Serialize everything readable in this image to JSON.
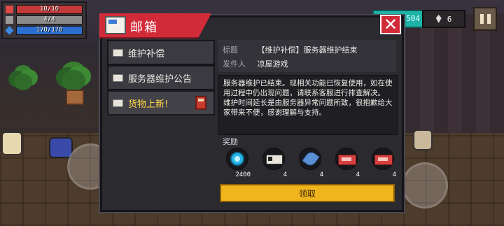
{
  "hud": {
    "hp": "10/10",
    "armor": "4/4",
    "energy": "170/170",
    "top_value": "504",
    "gems": "6"
  },
  "mailbox": {
    "title": "邮箱",
    "items": [
      {
        "label": "维护补偿"
      },
      {
        "label": "服务器维护公告"
      },
      {
        "label": "货物上新!"
      }
    ],
    "selected": 0,
    "meta": {
      "title_key": "标题",
      "title_value": "【维护补偿】服务器维护结束",
      "sender_key": "发件人",
      "sender_value": "凉屋游戏"
    },
    "body": "服务器维护已结束。现相关功能已恢复使用，如在使用过程中仍出现问题，请联系客服进行排查解决。\n维护时间延长是由服务器异常问题所致，很抱歉给大家带来不便，感谢理解与支持。",
    "rewards_label": "奖励",
    "rewards": [
      {
        "icon": "blue-gem-coin-icon",
        "count": "2400"
      },
      {
        "icon": "ticket-icon",
        "count": "4"
      },
      {
        "icon": "feather-icon",
        "count": "4"
      },
      {
        "icon": "red-card-icon",
        "count": "4"
      },
      {
        "icon": "red-card-icon",
        "count": "4"
      }
    ],
    "claim_label": "领取"
  },
  "colors": {
    "accent_red": "#d12b3a",
    "claim_yellow": "#f0b51d",
    "selected_text": "#ffd54a"
  }
}
